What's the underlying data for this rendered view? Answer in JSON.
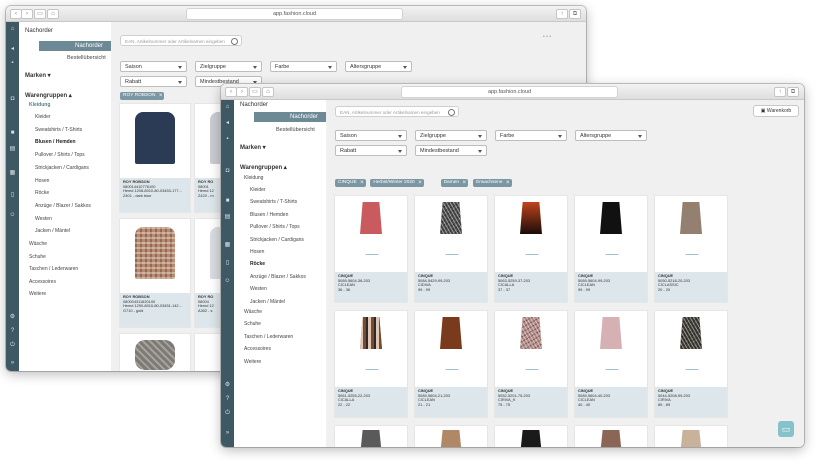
{
  "back": {
    "url": "app.fashion.cloud",
    "search_placeholder": "EAN, Artikelnummer oder Artikelnamen eingeben",
    "sidebar": {
      "nachorder": "Nachorder",
      "nachorder_sel": "Nachorder",
      "bestell": "Bestellübersicht",
      "marken": "Marken",
      "warengruppen": "Warengruppen",
      "kleidung": "Kleidung",
      "items": [
        "Kleider",
        "Sweatshirts / T-Shirts",
        "Blusen / Hemden",
        "Pullover / Shirts / Tops",
        "Strickjacken / Cardigans",
        "Hosen",
        "Röcke",
        "Anzüge / Blazer / Sakkos",
        "Westen",
        "Jacken / Mäntel"
      ],
      "top": [
        "Wäsche",
        "Schuhe",
        "Taschen / Lederwaren",
        "Accessoires",
        "Weitere"
      ]
    },
    "filters": [
      "Saison",
      "Zielgruppe",
      "Farbe",
      "Altersgruppe",
      "Rabatt",
      "Mindestbestand"
    ],
    "chips": [
      "ROY ROBSON"
    ],
    "cards": [
      {
        "brand": "ROY ROBSON",
        "l1": "080014410776100",
        "l2": "Hemd 1208-8010-80-03453-177...",
        "l3": "Z401 - dark blue",
        "kind": "shirt",
        "color": "#2b3a55"
      },
      {
        "brand": "ROY RO",
        "l1": "08001",
        "l2": "Hemd 12",
        "l3": "Z420 - m",
        "kind": "shirt",
        "color": "#c9ccd3"
      },
      {
        "brand": "ROY ROBSON",
        "l1": "080004311620100",
        "l2": "Hemd 1290-8010-80-03451-142...",
        "l3": "G710 - gold",
        "kind": "check",
        "color": "#b88a6f"
      },
      {
        "brand": "ROY RO",
        "l1": "08004",
        "l2": "Hemd 12",
        "l3": "A302 - s",
        "kind": "shirt",
        "color": "#d9dce0"
      }
    ]
  },
  "front": {
    "url": "app.fashion.cloud",
    "search_placeholder": "EAN, Artikelnummer oder Artikelnamen eingeben",
    "cart": "Warenkorb",
    "sidebar": {
      "nachorder": "Nachorder",
      "nachorder_sel": "Nachorder",
      "bestell": "Bestellübersicht",
      "marken": "Marken",
      "warengruppen": "Warengruppen",
      "kleidung": "Kleidung",
      "items": [
        "Kleider",
        "Sweatshirts / T-Shirts",
        "Blusen / Hemden",
        "Pullover / Shirts / Tops",
        "Strickjacken / Cardigans",
        "Hosen",
        "Röcke",
        "Anzüge / Blazer / Sakkos",
        "Westen",
        "Jacken / Mäntel"
      ],
      "top": [
        "Wäsche",
        "Schuhe",
        "Taschen / Lederwaren",
        "Accessoires",
        "Weitere"
      ]
    },
    "filters": [
      "Saison",
      "Zielgruppe",
      "Farbe",
      "Altersgruppe",
      "Rabatt",
      "Mindestbestand"
    ],
    "chips": [
      "CINQUE",
      "Herbst/Winter 2020",
      "Damen",
      "Erwachsene"
    ],
    "cards": [
      {
        "brand": "CINQUE",
        "l1": "5089-5604-36-203",
        "l2": "CICLEAN",
        "l3": "36 - 36",
        "color": "#c95b5f",
        "pattern": "solid"
      },
      {
        "brand": "CINQUE",
        "l1": "5084-5429-99-203",
        "l2": "CIDIVA",
        "l3": "99 - 99",
        "color": "#4b4b4b",
        "pattern": "print"
      },
      {
        "brand": "CINQUE",
        "l1": "5063-5259-37-203",
        "l2": "CICALLA",
        "l3": "37 - 37",
        "color": "#c1441d",
        "pattern": "gradient"
      },
      {
        "brand": "CINQUE",
        "l1": "5089-5604-99-203",
        "l2": "CICLEAN",
        "l3": "99 - 99",
        "color": "#111111",
        "pattern": "solid"
      },
      {
        "brand": "CINQUE",
        "l1": "5050-5218-20-203",
        "l2": "CICLASSIC",
        "l3": "20 - 20",
        "color": "#948070",
        "pattern": "solid"
      },
      {
        "brand": "CINQUE",
        "l1": "5061-5255-22-203",
        "l2": "CICALLA",
        "l3": "22 - 22",
        "color": "#8b5a3c",
        "pattern": "stripe"
      },
      {
        "brand": "CINQUE",
        "l1": "5089-5604-21-203",
        "l2": "CICLEAN",
        "l3": "21 - 21",
        "color": "#7a3a1c",
        "pattern": "solid"
      },
      {
        "brand": "CINQUE",
        "l1": "5052-5201-75-203",
        "l2": "CIRIVA_K",
        "l3": "75 - 75",
        "color": "#b38a86",
        "pattern": "print"
      },
      {
        "brand": "CINQUE",
        "l1": "5089-5604-40-203",
        "l2": "CICLEAN",
        "l3": "40 - 40",
        "color": "#d6b1b4",
        "pattern": "solid"
      },
      {
        "brand": "CINQUE",
        "l1": "5044-5208-99-203",
        "l2": "CIRIVA",
        "l3": "89 - 89",
        "color": "#3d3a32",
        "pattern": "print"
      }
    ],
    "cards_partial": [
      {
        "color": "#5a5a5a"
      },
      {
        "color": "#b08866"
      },
      {
        "color": "#1a1a1a"
      },
      {
        "color": "#8b6555"
      },
      {
        "color": "#c9b29a"
      }
    ]
  }
}
